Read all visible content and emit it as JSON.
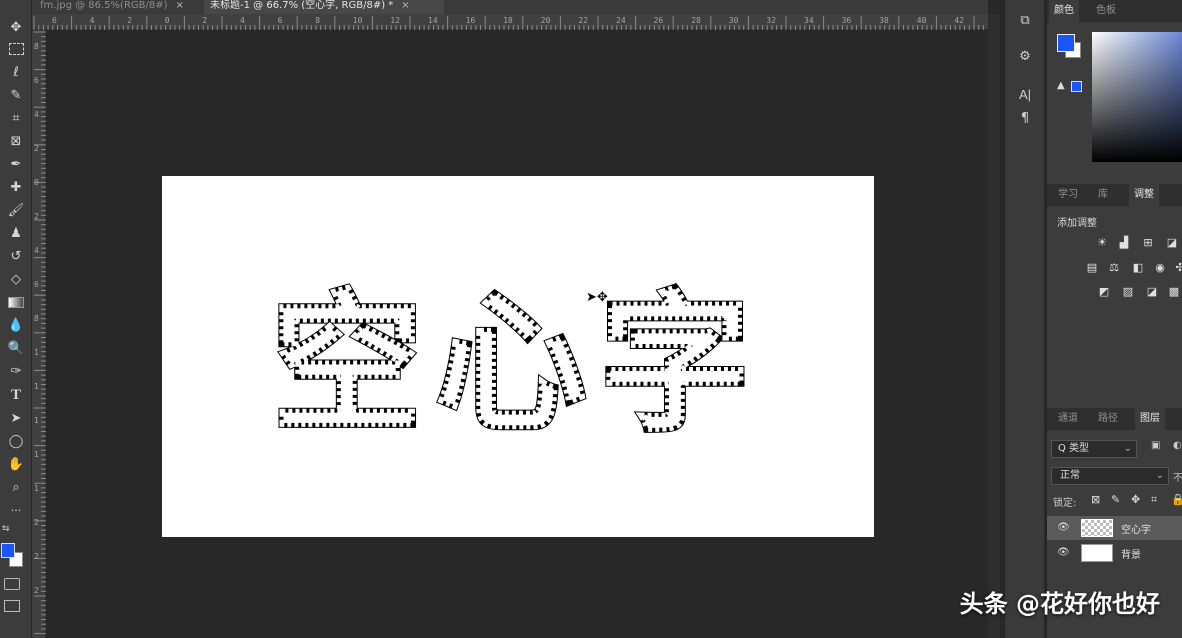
{
  "tabs": [
    {
      "label": "fm.jpg @ 86.5%(RGB/8#)",
      "close": "×"
    },
    {
      "label": "未标题-1 @ 66.7% (空心字, RGB/8#) *",
      "close": "×"
    }
  ],
  "ruler": {
    "h_labels": [
      "6",
      "4",
      "2",
      "0",
      "2",
      "4",
      "6",
      "8",
      "10",
      "12",
      "14",
      "16",
      "18",
      "20",
      "22",
      "24",
      "26",
      "28",
      "30",
      "32",
      "34",
      "36",
      "38",
      "40",
      "42"
    ],
    "v_labels": [
      "8",
      "6",
      "4",
      "2",
      "0",
      "2",
      "4",
      "6",
      "8",
      "1",
      "1",
      "1",
      "1",
      "1",
      "2",
      "2",
      "2"
    ]
  },
  "toolbar": {
    "tools": [
      "move-icon",
      "marquee-icon",
      "lasso-icon",
      "quick-select-icon",
      "crop-icon",
      "frame-icon",
      "eyedropper-icon",
      "healing-icon",
      "brush-icon",
      "stamp-icon",
      "history-brush-icon",
      "eraser-icon",
      "gradient-icon",
      "blur-icon",
      "dodge-icon",
      "pen-icon",
      "text-icon",
      "path-select-icon",
      "ellipse-icon",
      "hand-icon",
      "zoom-icon",
      "more-icon"
    ],
    "text_tool_glyph": "T",
    "more_glyph": "···",
    "foreground_color": "#1a55ff",
    "background_color": "#ffffff"
  },
  "canvas": {
    "text": "空心字",
    "background": "#ffffff"
  },
  "icon_strip": {
    "char_panel_glyph": "A|",
    "para_panel_glyph": "¶"
  },
  "color_panel": {
    "tabs": [
      "颜色",
      "色板"
    ],
    "foreground_color": "#1a55ff",
    "warning_glyph": "▲"
  },
  "adjust_panel": {
    "tabs": [
      "学习",
      "库",
      "调整"
    ],
    "title": "添加调整",
    "row1": [
      "brightness-icon",
      "levels-icon",
      "curves-icon",
      "exposure-icon"
    ],
    "row2": [
      "vibrance-icon",
      "balance-icon",
      "bw-icon",
      "photo-filter-icon",
      "channel-mixer-icon"
    ],
    "row3": [
      "invert-icon",
      "posterize-icon",
      "threshold-icon",
      "gradient-map-icon"
    ]
  },
  "layers_panel": {
    "tabs": [
      "通道",
      "路径",
      "图层"
    ],
    "filter_label": "Q 类型",
    "blend_mode": "正常",
    "opacity_prefix": "不",
    "lock_label": "锁定:",
    "layers": [
      {
        "name": "空心字",
        "thumb": "transparent",
        "selected": true
      },
      {
        "name": "背景",
        "thumb": "white",
        "selected": false
      }
    ]
  },
  "watermark": "头条 @花好你也好"
}
